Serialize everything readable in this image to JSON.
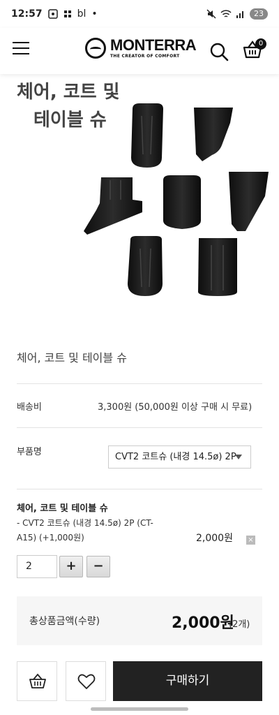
{
  "status_bar": {
    "time": "12:57",
    "left_extra": "bl",
    "battery": "23"
  },
  "header": {
    "brand": "MONTERRA",
    "tagline": "THE CREATOR OF COMFORT",
    "cart_count": "0"
  },
  "product": {
    "image_caption_line1": "체어, 코트 및",
    "image_caption_line2": "테이블 슈",
    "title": "체어, 코트 및 테이블 슈"
  },
  "shipping": {
    "label": "배송비",
    "value": "3,300원 (50,000원 이상 구매 시 무료)"
  },
  "part": {
    "label": "부품명",
    "selected": "CVT2 코트슈 (내경 14.5ø) 2P"
  },
  "selected_option": {
    "title": "체어, 코트 및 테이블 슈",
    "detail": "- CVT2 코트슈 (내경 14.5ø) 2P (CT-A15) (+1,000원)",
    "price": "2,000원",
    "remove": "×",
    "quantity": "2",
    "plus": "+",
    "minus": "−"
  },
  "total": {
    "label": "총상품금액(수량)",
    "amount": "2,000원",
    "count": "(2개)"
  },
  "actions": {
    "buy_label": "구매하기"
  },
  "colors": {
    "buy_button": "#222222",
    "total_bg": "#f6f6f6"
  }
}
